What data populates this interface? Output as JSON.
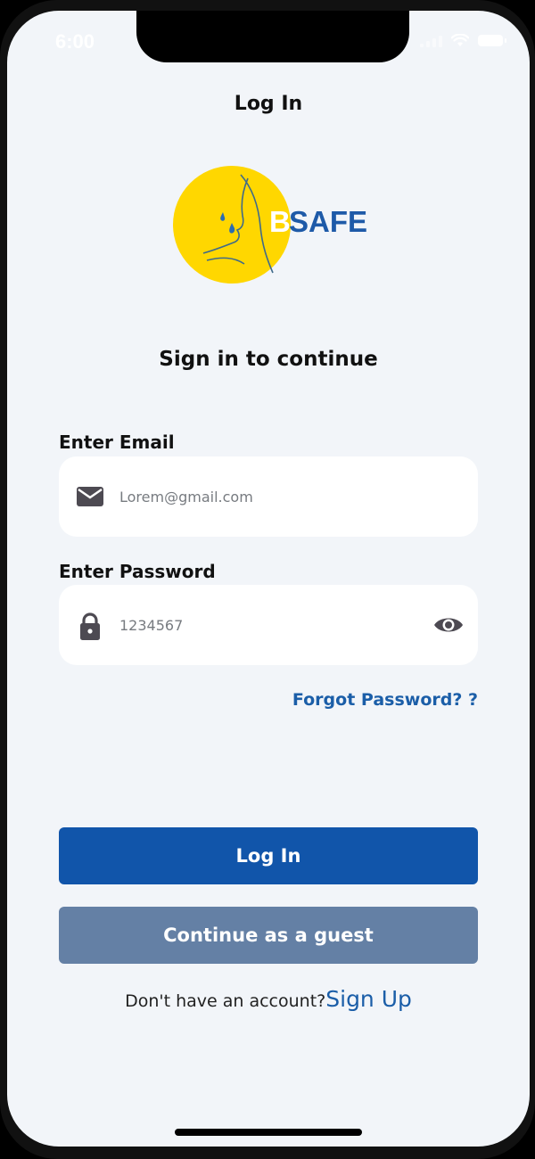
{
  "status_bar": {
    "time": "6:00"
  },
  "header": {
    "title": "Log In"
  },
  "logo": {
    "wordmark_b": "B",
    "wordmark_rest": "SAFE",
    "colors": {
      "circle": "#FFD700",
      "text": "#1E5AA8"
    }
  },
  "form": {
    "subtitle": "Sign in to continue",
    "email": {
      "label": "Enter Email",
      "value": "Lorem@gmail.com",
      "icon": "mail-icon"
    },
    "password": {
      "label": "Enter Password",
      "value": "1234567",
      "icon": "lock-icon",
      "toggle_icon": "eye-icon"
    },
    "forgot_label": "Forgot Password? ?"
  },
  "actions": {
    "login_label": "Log In",
    "guest_label": "Continue as a guest"
  },
  "footer": {
    "prompt": "Don't have an account?",
    "signup_label": "Sign Up"
  },
  "colors": {
    "primary": "#1155AA",
    "secondary": "#6480A5",
    "link": "#1B5EA8",
    "background": "#F2F5F9"
  }
}
